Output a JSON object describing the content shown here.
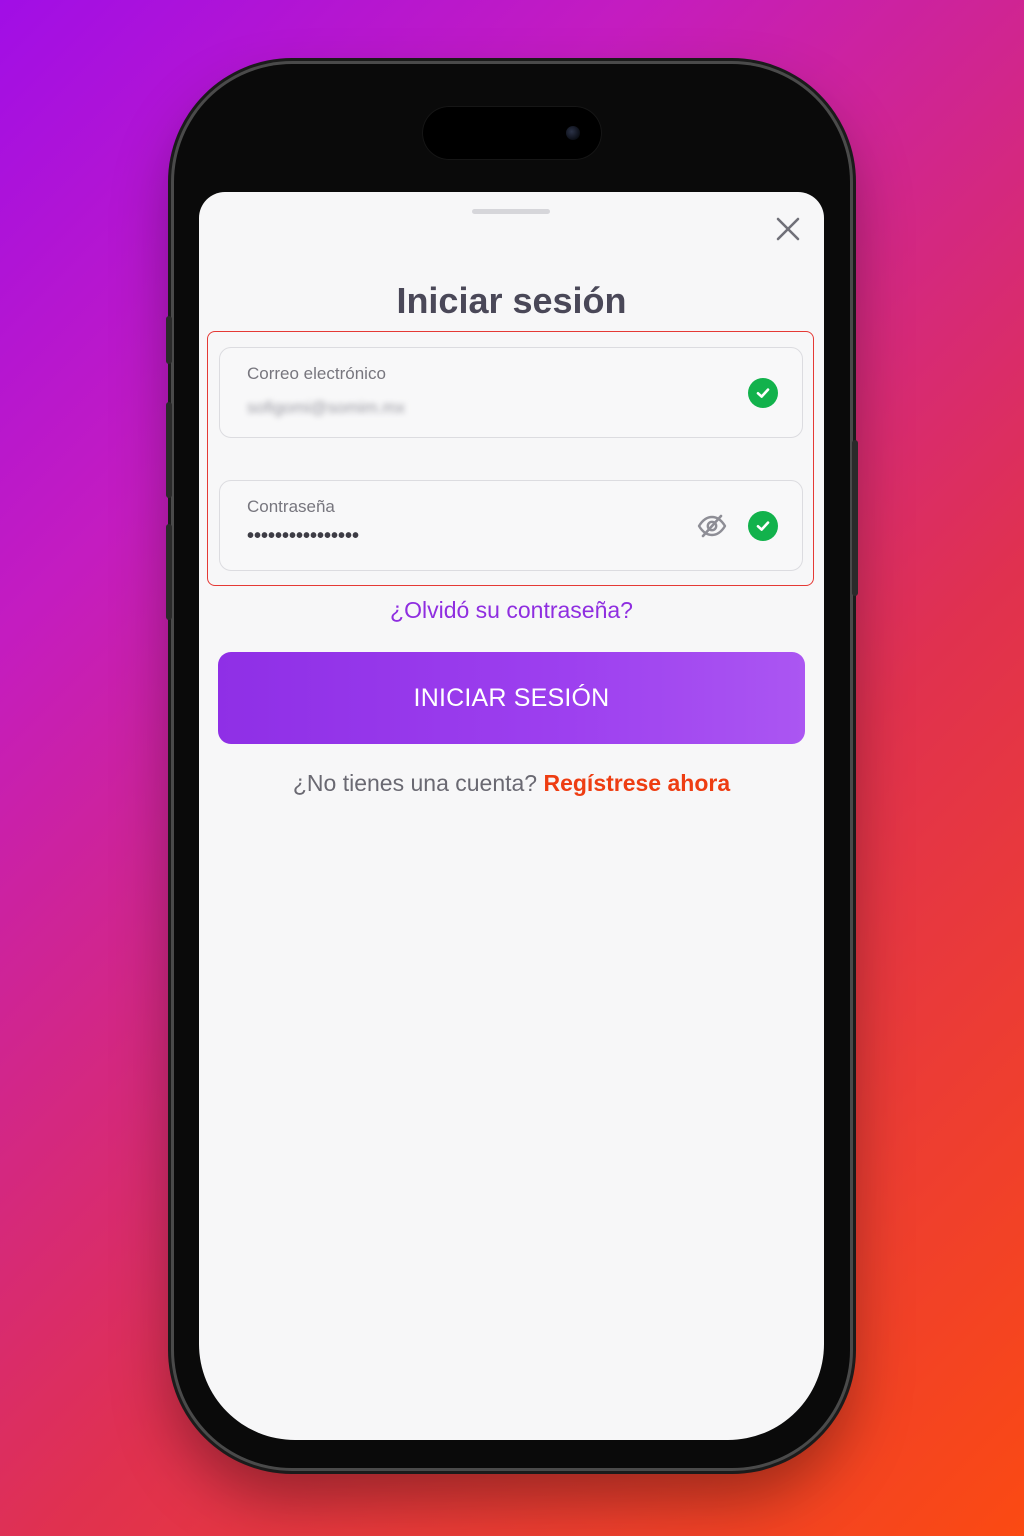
{
  "login": {
    "title": "Iniciar sesión",
    "email_label": "Correo electrónico",
    "email_value": "sofigomi@somim.mx",
    "password_label": "Contraseña",
    "password_value": "••••••••••••••••",
    "forgot_password": "¿Olvidó su contraseña?",
    "submit_button": "INICIAR SESIÓN",
    "no_account_text": "¿No tienes una cuenta?",
    "register_link": "Regístrese ahora"
  },
  "icons": {
    "close": "close-icon",
    "email_status": "check-circle-icon",
    "password_visibility": "eye-off-icon",
    "password_status": "check-circle-icon"
  },
  "colors": {
    "accent_purple": "#8f2ee0",
    "register_orange": "#ee3d12",
    "valid_green": "#12b24c",
    "highlight_red": "#e53935"
  }
}
